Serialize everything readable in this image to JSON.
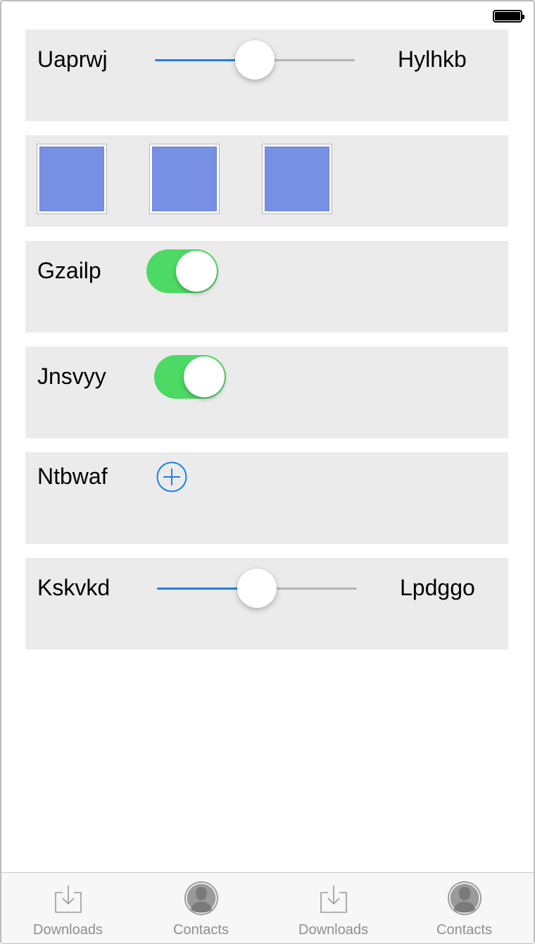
{
  "status_bar": {
    "battery_icon": "battery-full-icon"
  },
  "rows": [
    {
      "type": "slider",
      "label": "Uaprwj",
      "right_label": "Hylhkb",
      "value": 0.5
    },
    {
      "type": "squares",
      "count": 3,
      "color": "#7890e3"
    },
    {
      "type": "toggle",
      "label": "Gzailp",
      "on": true
    },
    {
      "type": "toggle",
      "label": "Jnsvyy",
      "on": true
    },
    {
      "type": "add",
      "label": "Ntbwaf",
      "icon": "add-circle-icon"
    },
    {
      "type": "slider",
      "label": "Kskvkd",
      "right_label": "Lpdggo",
      "value": 0.5
    }
  ],
  "tabs": [
    {
      "label": "Downloads",
      "icon": "downloads-icon"
    },
    {
      "label": "Contacts",
      "icon": "contacts-icon"
    },
    {
      "label": "Downloads",
      "icon": "downloads-icon"
    },
    {
      "label": "Contacts",
      "icon": "contacts-icon"
    }
  ],
  "colors": {
    "accent": "#1f7fe8",
    "toggle_on": "#4cd964",
    "card_bg": "#ebebeb",
    "tab_label": "#8e8e8e"
  }
}
